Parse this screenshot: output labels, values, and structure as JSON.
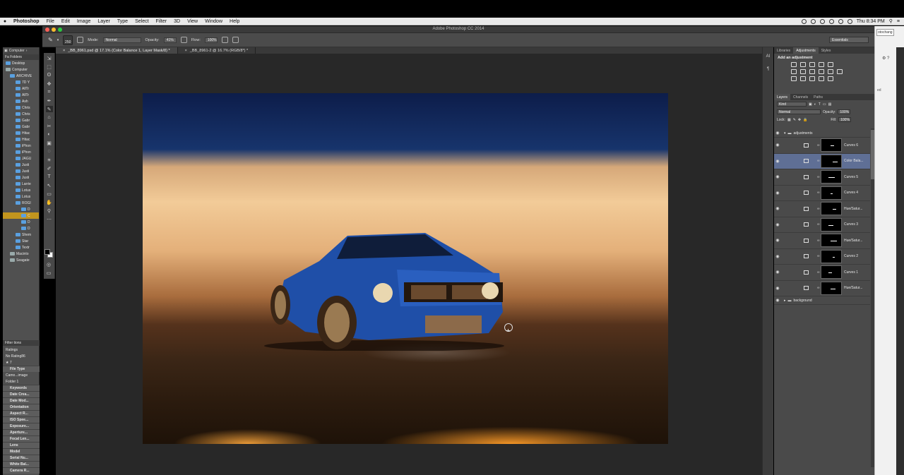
{
  "menubar": {
    "apple": "",
    "app": "Photoshop",
    "items": [
      "File",
      "Edit",
      "Image",
      "Layer",
      "Type",
      "Select",
      "Filter",
      "3D",
      "View",
      "Window",
      "Help"
    ],
    "clock": "Thu 8:34 PM"
  },
  "titlebar": {
    "title": "Adobe Photoshop CC 2014"
  },
  "options": {
    "brush_size": "250",
    "mode_label": "Mode:",
    "mode_value": "Normal",
    "opacity_label": "Opacity:",
    "opacity_value": "41%",
    "flow_label": "Flow:",
    "flow_value": "100%",
    "workspace": "Essentials"
  },
  "bridge": {
    "top": "Computer",
    "folders_header": "Fa  Folders",
    "tree": [
      {
        "label": "Desktop",
        "indent": 4,
        "kind": "folder"
      },
      {
        "label": "Computer",
        "indent": 4,
        "kind": "drive"
      },
      {
        "label": "ARCHIVE",
        "indent": 10,
        "kind": "folder"
      },
      {
        "label": "7D Y",
        "indent": 18,
        "kind": "folder"
      },
      {
        "label": "AllTr",
        "indent": 18,
        "kind": "folder"
      },
      {
        "label": "AllTr",
        "indent": 18,
        "kind": "folder"
      },
      {
        "label": "Ash",
        "indent": 18,
        "kind": "folder"
      },
      {
        "label": "Chris",
        "indent": 18,
        "kind": "folder"
      },
      {
        "label": "Chris",
        "indent": 18,
        "kind": "folder"
      },
      {
        "label": "Gabr",
        "indent": 18,
        "kind": "folder"
      },
      {
        "label": "Gabr",
        "indent": 18,
        "kind": "folder"
      },
      {
        "label": "Hitac",
        "indent": 18,
        "kind": "folder"
      },
      {
        "label": "Hitac",
        "indent": 18,
        "kind": "folder"
      },
      {
        "label": "iPhon",
        "indent": 18,
        "kind": "folder"
      },
      {
        "label": "iPhon",
        "indent": 18,
        "kind": "folder"
      },
      {
        "label": "JAGU",
        "indent": 18,
        "kind": "folder"
      },
      {
        "label": "Justi",
        "indent": 18,
        "kind": "folder"
      },
      {
        "label": "Justi",
        "indent": 18,
        "kind": "folder"
      },
      {
        "label": "Justi",
        "indent": 18,
        "kind": "folder"
      },
      {
        "label": "Larrie",
        "indent": 18,
        "kind": "folder"
      },
      {
        "label": "Lotus",
        "indent": 18,
        "kind": "folder"
      },
      {
        "label": "Lotus",
        "indent": 18,
        "kind": "folder"
      },
      {
        "label": "ROGI",
        "indent": 18,
        "kind": "folder"
      },
      {
        "label": "D",
        "indent": 26,
        "kind": "folder"
      },
      {
        "label": "C",
        "indent": 26,
        "kind": "folder",
        "selected": true
      },
      {
        "label": "D",
        "indent": 26,
        "kind": "folder"
      },
      {
        "label": "D",
        "indent": 26,
        "kind": "folder"
      },
      {
        "label": "Shem",
        "indent": 18,
        "kind": "folder"
      },
      {
        "label": "Star",
        "indent": 18,
        "kind": "folder"
      },
      {
        "label": "Textr",
        "indent": 18,
        "kind": "folder"
      },
      {
        "label": "Macinto",
        "indent": 10,
        "kind": "drive"
      },
      {
        "label": "Seagate",
        "indent": 10,
        "kind": "drive"
      }
    ],
    "filter_header": "Filter   tions",
    "filters": [
      {
        "label": "Ratings",
        "cat": false
      },
      {
        "label": "No Rating86",
        "cat": false
      },
      {
        "label": "★        7",
        "cat": false
      },
      {
        "label": "File Type",
        "cat": true
      },
      {
        "label": "Camo...image",
        "cat": false
      },
      {
        "label": "Folder       1",
        "cat": false
      },
      {
        "label": "Keywords",
        "cat": true
      },
      {
        "label": "Date Crea...",
        "cat": true
      },
      {
        "label": "Date Mod...",
        "cat": true
      },
      {
        "label": "Orientation",
        "cat": true
      },
      {
        "label": "Aspect R...",
        "cat": true
      },
      {
        "label": "ISO Spee...",
        "cat": true
      },
      {
        "label": "Exposure...",
        "cat": true
      },
      {
        "label": "Aperture...",
        "cat": true
      },
      {
        "label": "Focal Len...",
        "cat": true
      },
      {
        "label": "Lens",
        "cat": true
      },
      {
        "label": "Model",
        "cat": true
      },
      {
        "label": "Serial Nu...",
        "cat": true
      },
      {
        "label": "White Bal...",
        "cat": true
      },
      {
        "label": "Camera R...",
        "cat": true
      }
    ]
  },
  "tools": [
    "⇲",
    "⬚",
    "ʘ",
    "✥",
    "⌗",
    "✒",
    "✎",
    "⌂",
    "✂",
    "◐",
    "▣",
    "◌",
    "☀",
    "✐",
    "T",
    "↖",
    "▭",
    "✋",
    "⚲",
    "⋯"
  ],
  "doc": {
    "tabs": [
      {
        "label": "_BB_8961.psd @ 17.1% (Color Balance 1, Layer Mask/8) *",
        "active": true
      },
      {
        "label": "_BB_8961-2 @ 16.7% (RGB/8*) *",
        "active": false
      }
    ]
  },
  "iconstrip": [
    "AI",
    "¶"
  ],
  "panels": {
    "top_tabs": [
      {
        "label": "Libraries",
        "active": false
      },
      {
        "label": "Adjustments",
        "active": true
      },
      {
        "label": "Styles",
        "active": false
      }
    ],
    "add_adjustment": "Add an adjustment",
    "layer_tabs": [
      {
        "label": "Layers",
        "active": true
      },
      {
        "label": "Channels",
        "active": false
      },
      {
        "label": "Paths",
        "active": false
      }
    ],
    "kind": "Kind",
    "blend_mode": "Normal",
    "opacity_label": "Opacity:",
    "opacity_value": "100%",
    "lock_label": "Lock:",
    "fill_label": "Fill:",
    "fill_value": "100%",
    "layers": [
      {
        "name": "adjustments",
        "type": "group"
      },
      {
        "name": "Curves 6",
        "type": "adj"
      },
      {
        "name": "Color Bala...",
        "type": "adj",
        "selected": true
      },
      {
        "name": "Curves 5",
        "type": "adj"
      },
      {
        "name": "Curves 4",
        "type": "adj"
      },
      {
        "name": "Hue/Satur...",
        "type": "adj"
      },
      {
        "name": "Curves 3",
        "type": "adj"
      },
      {
        "name": "Hue/Satur...",
        "type": "adj"
      },
      {
        "name": "Curves 2",
        "type": "adj"
      },
      {
        "name": "Curves 1",
        "type": "adj"
      },
      {
        "name": "Hue/Satur...",
        "type": "adj"
      },
      {
        "name": "background",
        "type": "group"
      }
    ]
  },
  "rightedge": {
    "text1": "otochang",
    "text2": "ed"
  }
}
